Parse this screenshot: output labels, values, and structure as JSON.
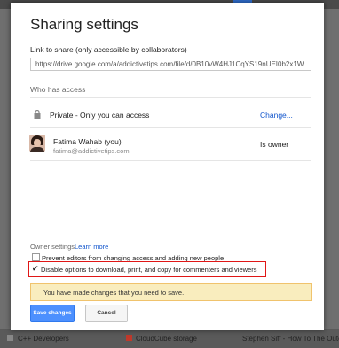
{
  "dialog": {
    "title": "Sharing settings",
    "link_label": "Link to share (only accessible by collaborators)",
    "link_value": "https://drive.google.com/a/addictivetips.com/file/d/0B10vW4HJ1CqYS19nUEI0b2x1W",
    "who_has_access_label": "Who has access",
    "access_entries": [
      {
        "icon": "lock-icon",
        "text": "Private - Only you can access",
        "action": "Change..."
      },
      {
        "icon": "avatar",
        "name": "Fatima Wahab (you)",
        "email": "fatima@addictivetips.com",
        "role": "Is owner"
      }
    ],
    "owner_settings_label": "Owner settings",
    "learn_more": "Learn more",
    "options": [
      {
        "label": "Prevent editors from changing access and adding new people",
        "checked": false
      },
      {
        "label": "Disable options to download, print, and copy for commenters and viewers",
        "checked": true
      }
    ],
    "notice": "You have made changes that you need to save.",
    "buttons": {
      "save": "Save changes",
      "cancel": "Cancel"
    },
    "colors": {
      "primary_button": "#4d90fe",
      "link": "#1155cc",
      "highlight_border": "#e01616",
      "notice_bg": "#f9edbe"
    }
  },
  "background": {
    "items": [
      "C++ Developers",
      "CloudCube storage",
      "Stephen Siff - How To The Outer"
    ]
  }
}
